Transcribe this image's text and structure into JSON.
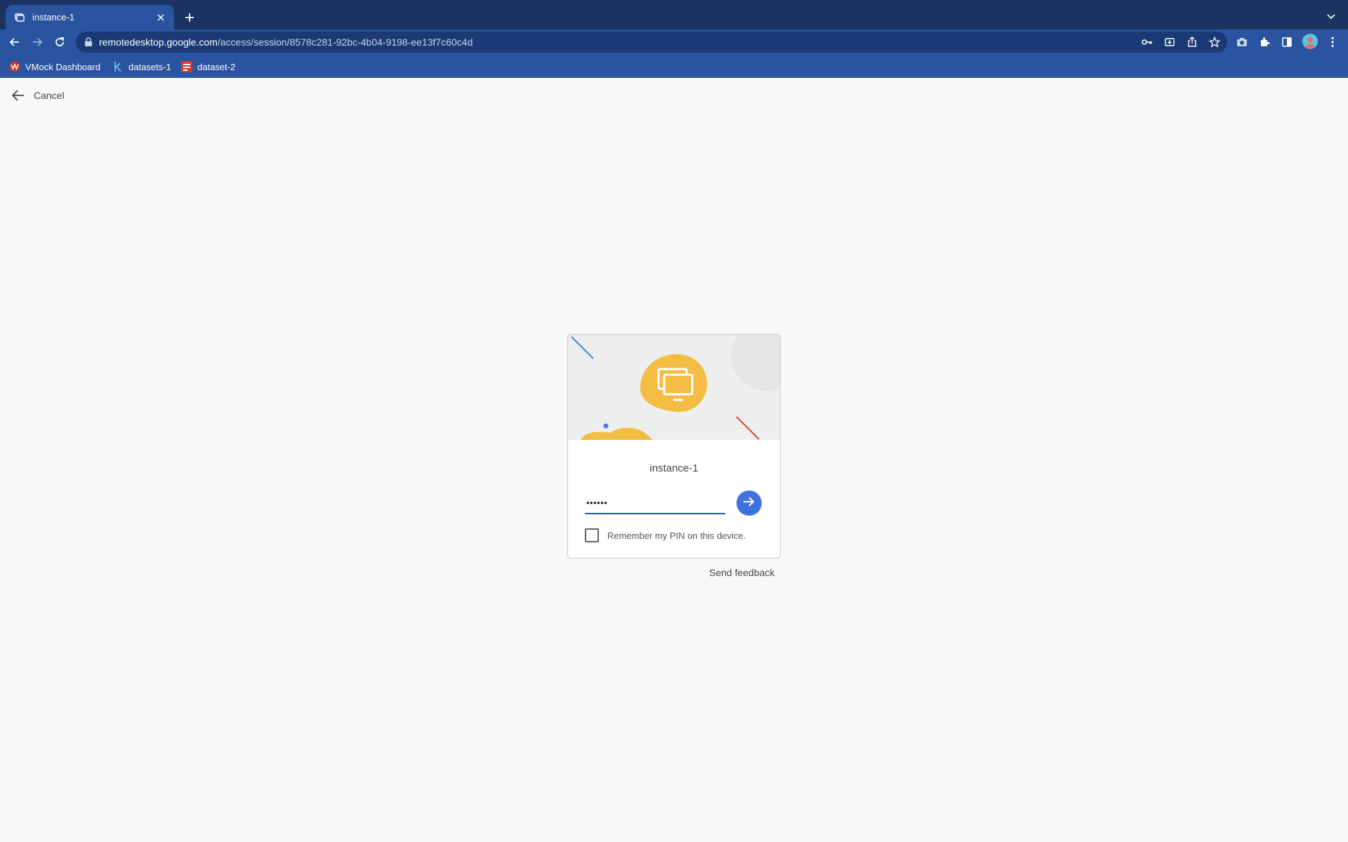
{
  "browser": {
    "tab": {
      "title": "instance-1"
    },
    "url": {
      "host": "remotedesktop.google.com",
      "path": "/access/session/8578c281-92bc-4b04-9198-ee13f7c60c4d"
    },
    "bookmarks": [
      {
        "label": "VMock Dashboard",
        "icon": "vmock-icon"
      },
      {
        "label": "datasets-1",
        "icon": "kaggle-icon"
      },
      {
        "label": "dataset-2",
        "icon": "dataset-icon"
      }
    ],
    "toolbar_icons": [
      "back-icon",
      "forward-icon",
      "reload-icon",
      "lock-icon",
      "key-icon",
      "install-icon",
      "share-icon",
      "star-icon",
      "camera-icon",
      "extensions-icon",
      "side-panel-icon",
      "avatar",
      "menu-icon"
    ]
  },
  "page": {
    "cancel_label": "Cancel",
    "host_name": "instance-1",
    "pin_value": "••••••",
    "remember_label": "Remember my PIN on this device.",
    "remember_checked": false,
    "feedback_label": "Send feedback"
  },
  "colors": {
    "accent": "#3f72e0",
    "art_yellow": "#f2bd42",
    "art_blue_line": "#4a7be8",
    "art_red_line": "#e0463a"
  }
}
